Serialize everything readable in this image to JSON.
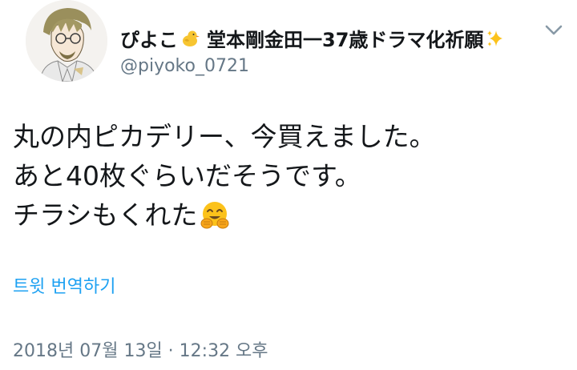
{
  "user": {
    "display_name_part1": "ぴよこ",
    "display_name_part2": "堂本剛金田一37歳ドラマ化祈願",
    "handle": "@piyoko_0721"
  },
  "tweet": {
    "lines": [
      "丸の内ピカデリー、今買えました。",
      "あと40枚ぐらいだそうです。",
      "チラシもくれた"
    ]
  },
  "translate_label": "트윗 번역하기",
  "timestamp": "2018년 07월 13일 · 12:32 오후",
  "icons": {
    "name_emoji_1": "baby-chick-icon",
    "name_emoji_2": "sparkles-icon",
    "text_emoji": "hugging-face-icon",
    "menu": "chevron-down-icon"
  },
  "colors": {
    "text": "#14171a",
    "secondary": "#657786",
    "link": "#1da1f2"
  }
}
